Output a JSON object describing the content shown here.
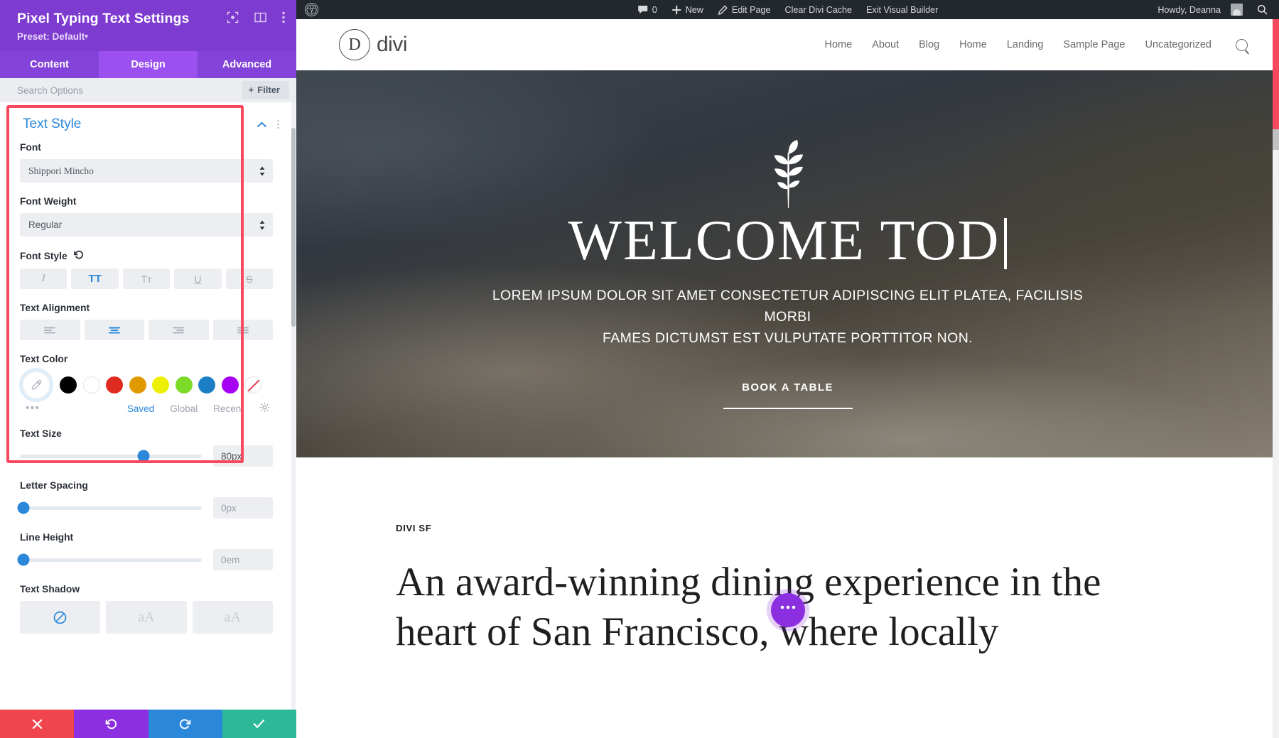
{
  "panel": {
    "title": "Pixel Typing Text Settings",
    "preset_label": "Preset: Default",
    "preset_caret": "▾",
    "header_icons": [
      {
        "name": "focus-icon",
        "glyph": "⦿"
      },
      {
        "name": "layout-icon",
        "glyph": "▥"
      },
      {
        "name": "more-options-icon",
        "glyph": "⋮"
      }
    ],
    "tabs": [
      {
        "label": "Content",
        "active": false
      },
      {
        "label": "Design",
        "active": true
      },
      {
        "label": "Advanced",
        "active": false
      }
    ],
    "search_placeholder": "Search Options",
    "filter_label": "Filter",
    "filter_plus": "+",
    "section": {
      "title": "Text Style",
      "collapse_glyph": "⌃",
      "menu_glyph": "⋮"
    },
    "font": {
      "label": "Font",
      "value": "Shippori Mincho"
    },
    "font_weight": {
      "label": "Font Weight",
      "value": "Regular"
    },
    "font_style": {
      "label": "Font Style",
      "reset_glyph": "↺",
      "options": [
        {
          "name": "italic",
          "glyph": "I",
          "active": false
        },
        {
          "name": "uppercase",
          "glyph": "TT",
          "active": true
        },
        {
          "name": "small-caps",
          "glyph": "Tᴛ",
          "active": false
        },
        {
          "name": "underline",
          "glyph": "U",
          "active": false
        },
        {
          "name": "strikethrough",
          "glyph": "S",
          "active": false
        }
      ]
    },
    "text_alignment": {
      "label": "Text Alignment",
      "options": [
        {
          "name": "align-left",
          "active": false
        },
        {
          "name": "align-center",
          "active": true
        },
        {
          "name": "align-right",
          "active": false
        },
        {
          "name": "align-justify",
          "active": false
        }
      ]
    },
    "text_color": {
      "label": "Text Color",
      "eyedropper_glyph": "⚲",
      "swatches": [
        {
          "name": "black",
          "hex": "#000000"
        },
        {
          "name": "white",
          "hex": "#ffffff"
        },
        {
          "name": "red",
          "hex": "#e02b20"
        },
        {
          "name": "orange",
          "hex": "#e09900"
        },
        {
          "name": "yellow",
          "hex": "#edf000"
        },
        {
          "name": "green",
          "hex": "#7cdb28"
        },
        {
          "name": "blue",
          "hex": "#1c7ec4"
        },
        {
          "name": "purple",
          "hex": "#a601f2"
        },
        {
          "name": "transparent",
          "hex": "none"
        }
      ],
      "more_glyph": "•••",
      "links": [
        {
          "label": "Saved",
          "active": true
        },
        {
          "label": "Global",
          "active": false
        },
        {
          "label": "Recent",
          "active": false
        }
      ],
      "settings_glyph": "⚙"
    },
    "text_size": {
      "label": "Text Size",
      "value": "80px",
      "slider_percent": 68
    },
    "letter_spacing": {
      "label": "Letter Spacing",
      "value": "0px",
      "slider_percent": 2
    },
    "line_height": {
      "label": "Line Height",
      "value": "0em",
      "slider_percent": 2
    },
    "text_shadow": {
      "label": "Text Shadow",
      "options": [
        {
          "name": "none",
          "glyph": "⊘",
          "active": true
        },
        {
          "name": "shadow-preset-1",
          "glyph": "aA",
          "active": false
        },
        {
          "name": "shadow-preset-2",
          "glyph": "aA",
          "active": false
        }
      ]
    },
    "actions": [
      {
        "name": "cancel",
        "glyph": "✕",
        "color": "#f0454e"
      },
      {
        "name": "undo",
        "glyph": "↺",
        "color": "#8b2fe0"
      },
      {
        "name": "redo",
        "glyph": "↻",
        "color": "#2b87da"
      },
      {
        "name": "save",
        "glyph": "✓",
        "color": "#2db898"
      }
    ]
  },
  "adminbar": {
    "wp_glyph": "W",
    "comments_count": "0",
    "comments_glyph": "💬",
    "new_label": "New",
    "new_glyph": "+",
    "edit_page_label": "Edit Page",
    "edit_glyph": "✎",
    "clear_cache_label": "Clear Divi Cache",
    "exit_builder_label": "Exit Visual Builder",
    "howdy_label": "Howdy, Deanna",
    "search_glyph": "⌕"
  },
  "site": {
    "logo_mark": "D",
    "logo_text": "divi",
    "nav": [
      {
        "label": "Home"
      },
      {
        "label": "About"
      },
      {
        "label": "Blog"
      },
      {
        "label": "Home"
      },
      {
        "label": "Landing"
      },
      {
        "label": "Sample Page"
      },
      {
        "label": "Uncategorized"
      }
    ],
    "search_icon": "search-icon"
  },
  "hero": {
    "headline": "WELCOME TOD",
    "subtitle_line1": "LOREM IPSUM DOLOR SIT AMET CONSECTETUR ADIPISCING ELIT PLATEA, FACILISIS MORBI",
    "subtitle_line2": "FAMES DICTUMST EST VULPUTATE PORTTITOR NON.",
    "cta_label": "BOOK A TABLE"
  },
  "section2": {
    "eyebrow": "DIVI SF",
    "heading": "An award-winning dining experience in the heart of San Francisco, where locally",
    "fab_glyph": "•••"
  }
}
